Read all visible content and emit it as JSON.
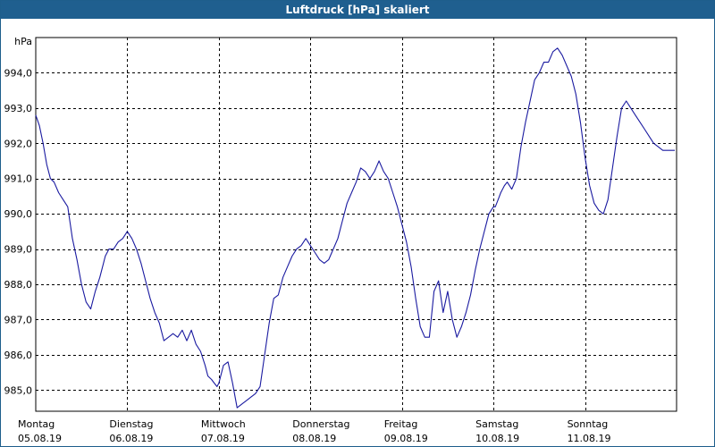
{
  "window": {
    "title": "Luftdruck [hPa] skaliert"
  },
  "chart_data": {
    "type": "line",
    "title": "Luftdruck [hPa] skaliert",
    "ylabel": "hPa",
    "xlabel": "",
    "grid": true,
    "ylim": [
      984.4,
      995.0
    ],
    "yticks": [
      985,
      986,
      987,
      988,
      989,
      990,
      991,
      992,
      993,
      994
    ],
    "ytick_labels": [
      "985,0",
      "986,0",
      "987,0",
      "988,0",
      "989,0",
      "990,0",
      "991,0",
      "992,0",
      "993,0",
      "994,0"
    ],
    "xlim": [
      0,
      7
    ],
    "x_unit": "day",
    "days": [
      {
        "day": "Montag",
        "date": "05.08.19"
      },
      {
        "day": "Dienstag",
        "date": "06.08.19"
      },
      {
        "day": "Mittwoch",
        "date": "07.08.19"
      },
      {
        "day": "Donnerstag",
        "date": "08.08.19"
      },
      {
        "day": "Freitag",
        "date": "09.08.19"
      },
      {
        "day": "Samstag",
        "date": "10.08.19"
      },
      {
        "day": "Sonntag",
        "date": "11.08.19"
      }
    ],
    "colors": {
      "line": "#1a1aa0",
      "grid": "#000000"
    },
    "series": [
      {
        "x": [
          0.0,
          0.04,
          0.08,
          0.12,
          0.16,
          0.2,
          0.25,
          0.3,
          0.35,
          0.4,
          0.45,
          0.5,
          0.55,
          0.6,
          0.65,
          0.7,
          0.74,
          0.76,
          0.8,
          0.85,
          0.9,
          0.95,
          1.0,
          1.05,
          1.1,
          1.15,
          1.2,
          1.25,
          1.3,
          1.35,
          1.4,
          1.45,
          1.5,
          1.55,
          1.6,
          1.65,
          1.7,
          1.75,
          1.8,
          1.85,
          1.88,
          1.92,
          1.95,
          1.98,
          2.0,
          2.05,
          2.1,
          2.15,
          2.2,
          2.25,
          2.3,
          2.35,
          2.4,
          2.45,
          2.5,
          2.55,
          2.6,
          2.65,
          2.7,
          2.75,
          2.8,
          2.85,
          2.9,
          2.95,
          3.0,
          3.05,
          3.1,
          3.15,
          3.2,
          3.25,
          3.3,
          3.35,
          3.4,
          3.45,
          3.5,
          3.55,
          3.6,
          3.65,
          3.7,
          3.75,
          3.8,
          3.85,
          3.9,
          3.95,
          4.0,
          4.05,
          4.1,
          4.15,
          4.2,
          4.25,
          4.3,
          4.35,
          4.4,
          4.45,
          4.5,
          4.55,
          4.6,
          4.65,
          4.7,
          4.75,
          4.8,
          4.85,
          4.9,
          4.95,
          5.0,
          5.02,
          5.05,
          5.08,
          5.12,
          5.15,
          5.2,
          5.25,
          5.3,
          5.35,
          5.4,
          5.45,
          5.5,
          5.55,
          5.6,
          5.65,
          5.7,
          5.75,
          5.8,
          5.85,
          5.9,
          5.95,
          6.0,
          6.05,
          6.1,
          6.15,
          6.2,
          6.25,
          6.3,
          6.35,
          6.4,
          6.45,
          6.5,
          6.55,
          6.6,
          6.65,
          6.7,
          6.75,
          6.8,
          6.85,
          6.9,
          6.95,
          6.98
        ],
        "values": [
          992.8,
          992.5,
          992.0,
          991.4,
          991.0,
          990.9,
          990.6,
          990.4,
          990.2,
          989.3,
          988.7,
          988.0,
          987.5,
          987.3,
          987.8,
          988.2,
          988.6,
          988.8,
          989.0,
          989.0,
          989.2,
          989.3,
          989.5,
          989.3,
          989.0,
          988.6,
          988.1,
          987.6,
          987.2,
          986.9,
          986.4,
          986.5,
          986.6,
          986.5,
          986.7,
          986.4,
          986.7,
          986.3,
          986.1,
          985.7,
          985.4,
          985.3,
          985.2,
          985.1,
          985.2,
          985.7,
          985.8,
          985.2,
          984.5,
          984.6,
          984.7,
          984.8,
          984.9,
          985.1,
          986.0,
          986.9,
          987.6,
          987.7,
          988.2,
          988.5,
          988.8,
          989.0,
          989.1,
          989.3,
          989.1,
          988.9,
          988.7,
          988.6,
          988.7,
          989.0,
          989.3,
          989.8,
          990.3,
          990.6,
          990.9,
          991.3,
          991.2,
          991.0,
          991.2,
          991.5,
          991.2,
          991.0,
          990.6,
          990.2,
          989.7,
          989.2,
          988.5,
          987.6,
          986.8,
          986.5,
          986.5,
          987.8,
          988.1,
          987.2,
          987.8,
          987.0,
          986.5,
          986.8,
          987.2,
          987.7,
          988.4,
          989.0,
          989.5,
          990.0,
          990.2,
          990.2,
          990.4,
          990.6,
          990.8,
          990.9,
          990.7,
          991.0,
          991.9,
          992.6,
          993.2,
          993.8,
          994.0,
          994.3,
          994.3,
          994.6,
          994.7,
          994.5,
          994.2,
          993.9,
          993.4,
          992.6,
          991.6,
          990.8,
          990.3,
          990.1,
          990.0,
          990.4,
          991.3,
          992.2,
          993.0,
          993.2,
          993.0,
          992.8,
          992.6,
          992.4,
          992.2,
          992.0,
          991.9,
          991.8,
          991.8,
          991.8,
          991.8
        ]
      }
    ]
  }
}
